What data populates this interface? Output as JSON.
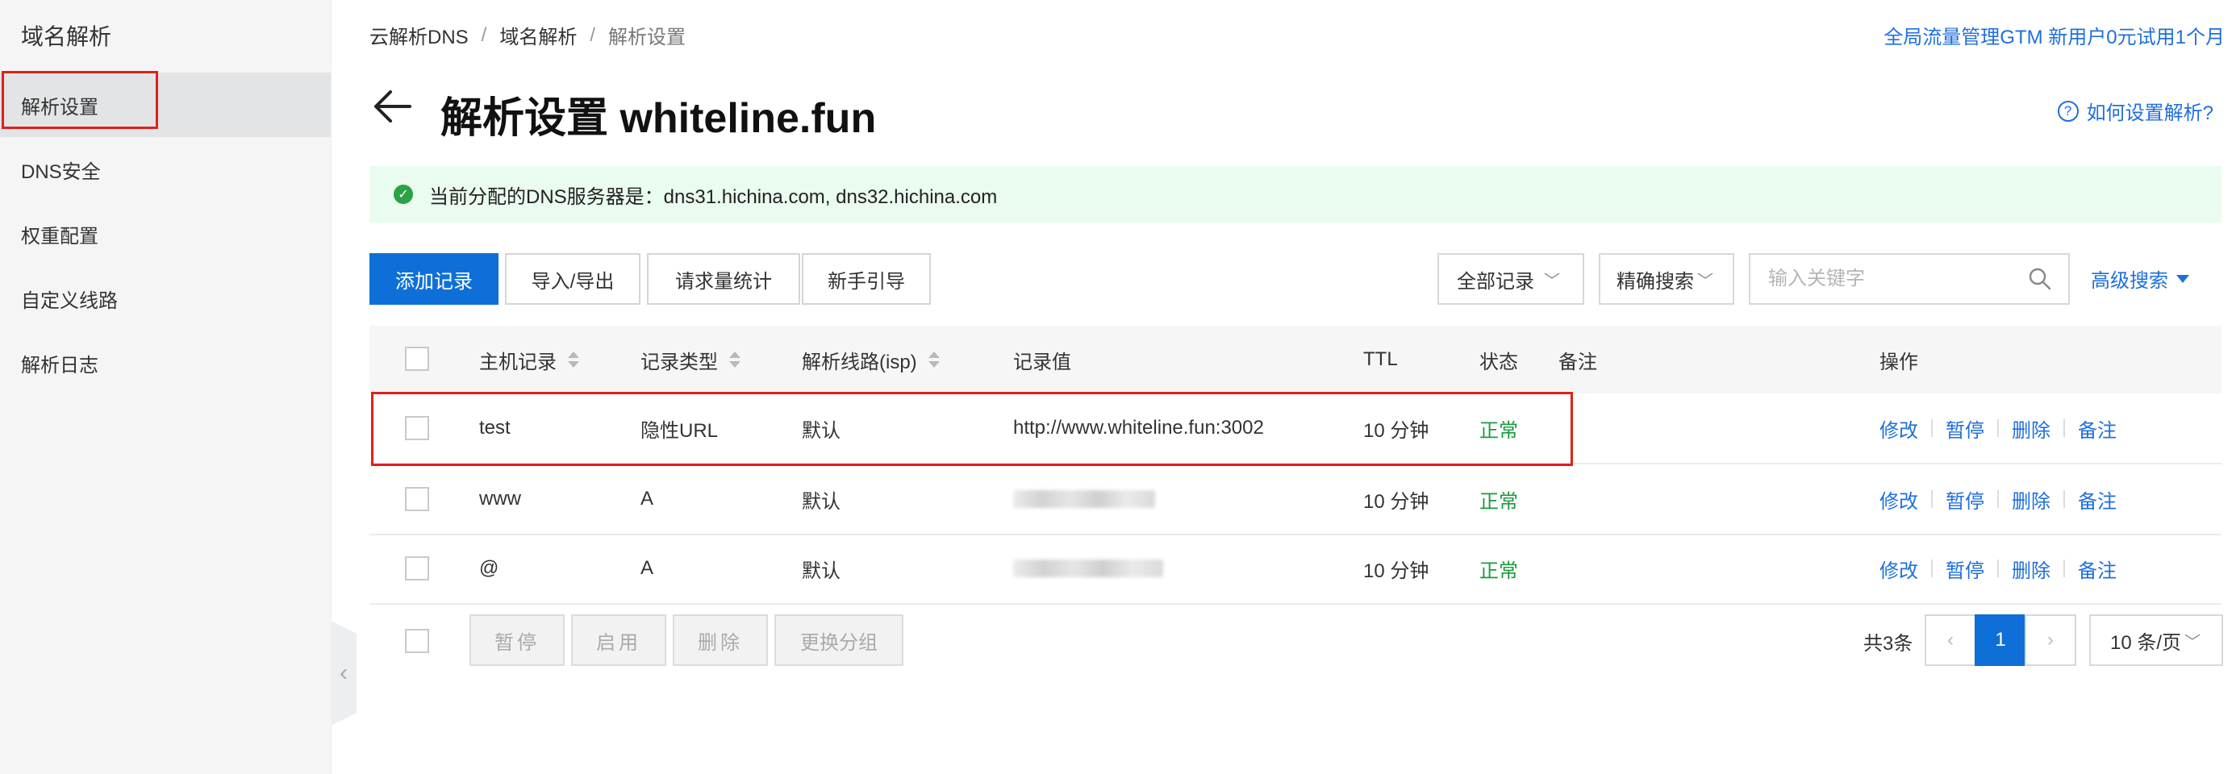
{
  "sidebar": {
    "title": "域名解析",
    "items": [
      {
        "label": "解析设置",
        "active": true
      },
      {
        "label": "DNS安全"
      },
      {
        "label": "权重配置"
      },
      {
        "label": "自定义线路"
      },
      {
        "label": "解析日志"
      }
    ]
  },
  "breadcrumb": [
    "云解析DNS",
    "域名解析",
    "解析设置"
  ],
  "breadcrumb_sep": "/",
  "promo": "全局流量管理GTM 新用户0元试用1个月",
  "page_title": "解析设置 whiteline.fun",
  "help_link": "如何设置解析?",
  "notice": "当前分配的DNS服务器是：dns31.hichina.com, dns32.hichina.com",
  "toolbar": {
    "add": "添加记录",
    "import_export": "导入/导出",
    "request_stats": "请求量统计",
    "guide": "新手引导",
    "filter_select": "全部记录",
    "search_mode": "精确搜索",
    "search_placeholder": "输入关键字",
    "advanced": "高级搜索"
  },
  "table": {
    "columns": {
      "host": "主机记录",
      "type": "记录类型",
      "line": "解析线路(isp)",
      "value": "记录值",
      "ttl": "TTL",
      "status": "状态",
      "remark": "备注",
      "ops": "操作"
    },
    "rows": [
      {
        "host": "test",
        "type": "隐性URL",
        "line": "默认",
        "value": "http://www.whiteline.fun:3002",
        "ttl": "10 分钟",
        "status": "正常"
      },
      {
        "host": "www",
        "type": "A",
        "line": "默认",
        "value": "",
        "ttl": "10 分钟",
        "status": "正常"
      },
      {
        "host": "@",
        "type": "A",
        "line": "默认",
        "value": "",
        "ttl": "10 分钟",
        "status": "正常"
      }
    ],
    "row_actions": [
      "修改",
      "暂停",
      "删除",
      "备注"
    ]
  },
  "footer": {
    "bulk": [
      "暂停",
      "启用",
      "删除",
      "更换分组"
    ],
    "total": "共3条",
    "current_page": "1",
    "page_size": "10 条/页"
  },
  "colors": {
    "accent": "#0f6fd8",
    "link": "#1f6fdc",
    "success": "#1a9a3a",
    "notice_bg": "#eafbef",
    "highlight": "#e0201a"
  }
}
